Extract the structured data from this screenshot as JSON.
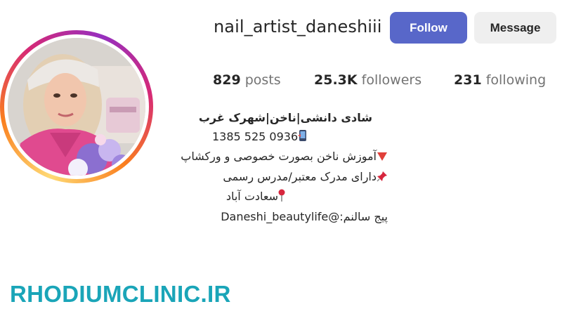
{
  "profile": {
    "username": "nail_artist_daneshiii",
    "follow_label": "Follow",
    "message_label": "Message"
  },
  "stats": {
    "posts_count": "829",
    "posts_label": "posts",
    "followers_count": "25.3K",
    "followers_label": "followers",
    "following_count": "231",
    "following_label": "following"
  },
  "bio": {
    "name": "شادی دانشی|ناخن|شهرک غرب",
    "phone": "1385 525 0936",
    "line_training": "آموزش ناخن بصورت خصوصی و ورکشاپ",
    "line_certificate": "دارای مدرک معتبر/مدرس رسمی",
    "line_location": "سعادت آباد",
    "line_link": "پیج سالنم:@Daneshi_beautylife"
  },
  "icons": {
    "phone": "mobile-phone-icon",
    "training": "red-triangle-icon",
    "certificate": "pushpin-icon",
    "location": "round-pushpin-icon"
  },
  "colors": {
    "follow_button": "#5867c9",
    "message_button": "#efefef",
    "story_ring": "#d62976",
    "watermark": "#1aa5b8"
  },
  "watermark": "RHODIUMCLINIC.IR"
}
